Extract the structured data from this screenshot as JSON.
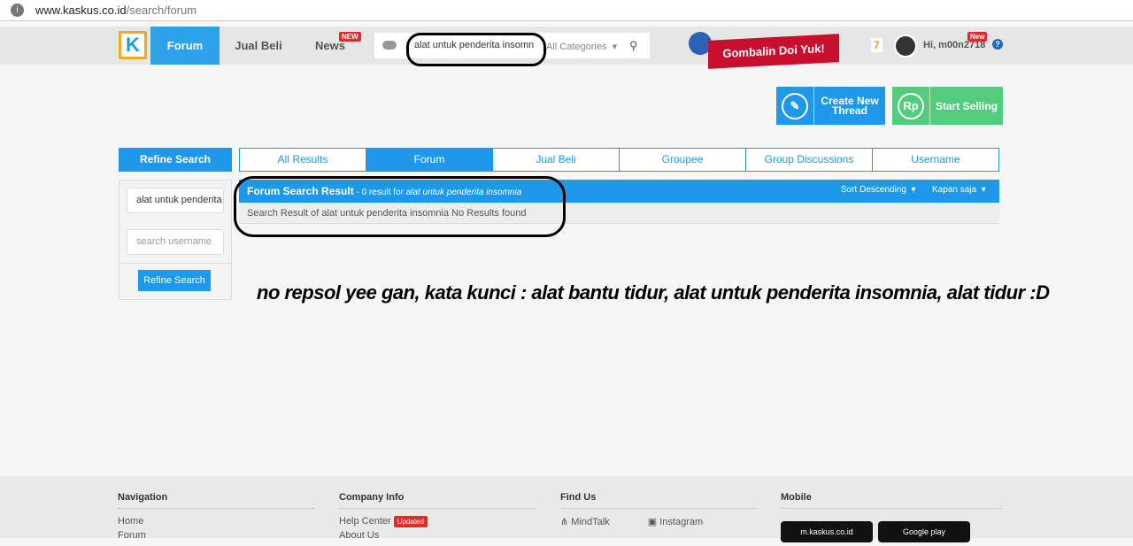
{
  "browser": {
    "url_host": "www.kaskus.co.id",
    "url_path": "/search/forum"
  },
  "nav": {
    "logo": "K",
    "tabs": [
      {
        "label": "Forum"
      },
      {
        "label": "Jual Beli"
      },
      {
        "label": "News"
      }
    ],
    "news_badge": "NEW",
    "search_value": "alat untuk penderita insomn",
    "category": "All Categories",
    "promo": "Gombalin Doi Yuk!",
    "notif_count": "7",
    "greeting": "Hi, m00n2718",
    "user_badge": "New",
    "help": "?"
  },
  "actions": {
    "create": "Create New Thread",
    "sell": "Start Selling",
    "rp": "Rp"
  },
  "refine": {
    "title": "Refine Search",
    "keyword": "alat untuk penderita insomnia",
    "username_placeholder": "search username",
    "button": "Refine Search"
  },
  "tabs": [
    {
      "label": "All Results"
    },
    {
      "label": "Forum"
    },
    {
      "label": "Jual Beli"
    },
    {
      "label": "Groupee"
    },
    {
      "label": "Group Discussions"
    },
    {
      "label": "Username"
    }
  ],
  "result": {
    "title": "Forum Search Result",
    "count_text": " - 0 result for ",
    "query": "alat untuk penderita insomnia",
    "sort": "Sort Descending",
    "time": "Kapan saja",
    "message": "Search Result of alat untuk penderita insomnia No Results found"
  },
  "annotation": "no repsol yee gan, kata kunci : alat bantu tidur, alat untuk penderita insomnia, alat tidur :D",
  "footer": {
    "navigation": {
      "title": "Navigation",
      "items": [
        "Home",
        "Forum"
      ]
    },
    "company": {
      "title": "Company Info",
      "items": [
        "Help Center",
        "About Us"
      ],
      "badge": "Updated"
    },
    "findus": {
      "title": "Find Us",
      "items": [
        "MindTalk",
        "Instagram"
      ]
    },
    "mobile": {
      "title": "Mobile",
      "items": [
        "m.kaskus.co.id",
        "Google play"
      ]
    }
  },
  "colors": {
    "primary": "#1e98e8",
    "green": "#53cd7d",
    "badge": "#e02b2b"
  }
}
